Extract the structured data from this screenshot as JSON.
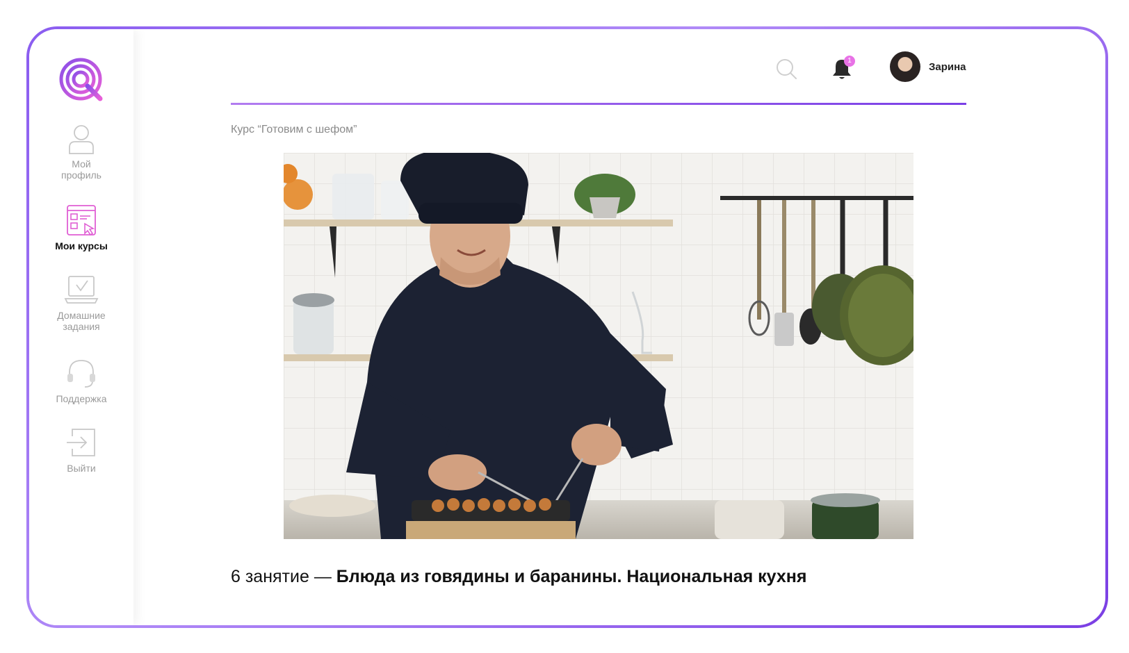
{
  "sidebar": {
    "logo": "q-logo-icon",
    "items": [
      {
        "label": "Мой\nпрофиль",
        "icon": "user-icon",
        "active": false
      },
      {
        "label": "Мои курсы",
        "icon": "courses-icon",
        "active": true
      },
      {
        "label": "Домашние\nзадания",
        "icon": "homework-laptop-icon",
        "active": false
      },
      {
        "label": "Поддержка",
        "icon": "headset-icon",
        "active": false
      },
      {
        "label": "Выйти",
        "icon": "logout-icon",
        "active": false
      }
    ]
  },
  "header": {
    "notification_count": "1",
    "user_name": "Зарина"
  },
  "breadcrumb": "Курс “Готовим с шефом”",
  "lesson": {
    "number_text": "6 занятие — ",
    "title": "Блюда из говядины и баранины. Национальная кухня"
  },
  "colors": {
    "accent": "#8a4fe8",
    "accent_pink": "#e872e6",
    "muted_text": "#9a9a9a"
  }
}
